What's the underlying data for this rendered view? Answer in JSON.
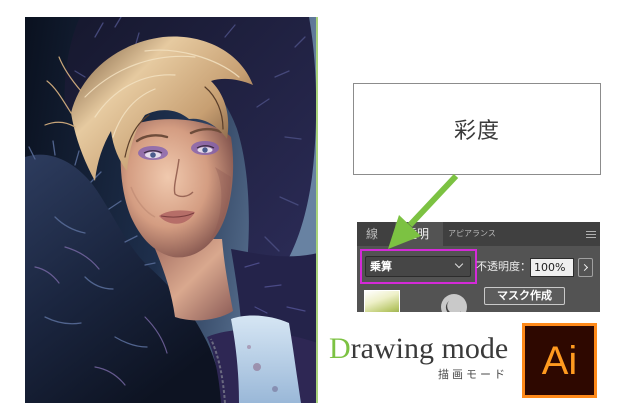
{
  "callout": {
    "label": "彩度"
  },
  "panel": {
    "tabs": [
      {
        "label": "線",
        "active": false
      },
      {
        "label": "透明",
        "active": true
      },
      {
        "label": "アピアランス",
        "active": false
      }
    ],
    "menu_icon": "menu-icon",
    "blend_mode": {
      "selected": "乗算",
      "icon": "chevron-down-icon"
    },
    "opacity": {
      "label": "不透明度：",
      "value": "100%",
      "icon": "chevron-right-icon"
    },
    "mask_icon": "mask-link-icon",
    "mask_button": {
      "label": "マスク作成"
    }
  },
  "heading": {
    "first_letter": "D",
    "rest": "rawing mode",
    "subtitle": "描画モード"
  },
  "logo": {
    "text": "Ai"
  },
  "colors": {
    "accent_green": "#7cc242",
    "highlight_magenta": "#d42ad8",
    "panel_bg": "#535353",
    "logo_orange": "#ff8a1a",
    "logo_bg": "#2e0800",
    "photo_edge": "#a9d37c"
  }
}
